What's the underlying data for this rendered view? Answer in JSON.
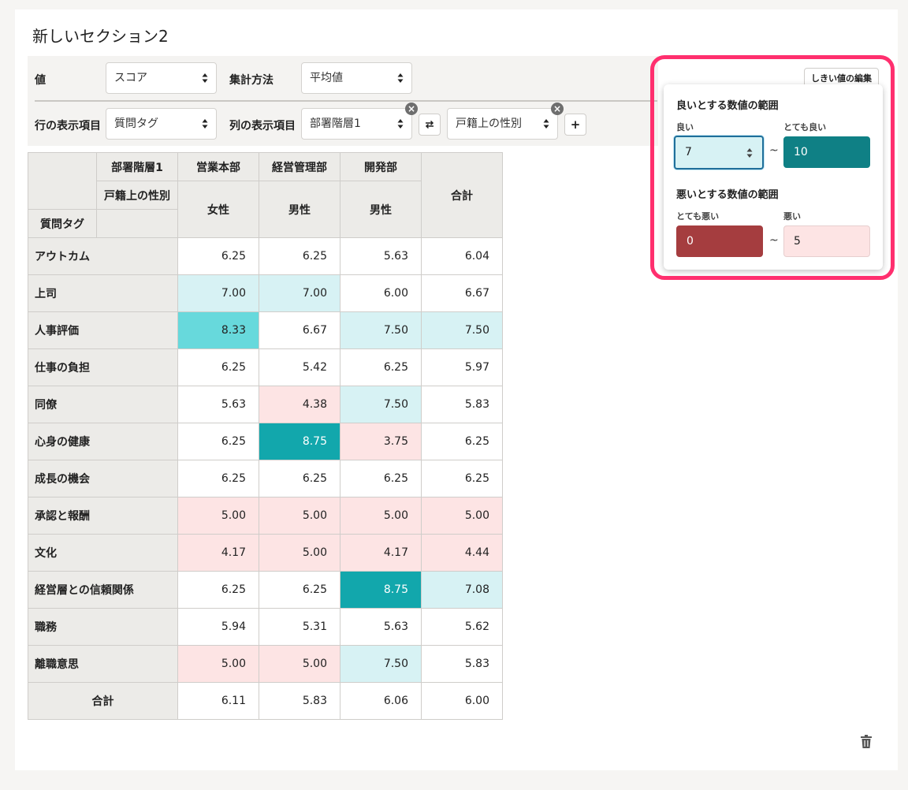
{
  "section": {
    "title": "新しいセクション2"
  },
  "toolbar": {
    "value_label": "値",
    "value_select": "スコア",
    "aggregation_label": "集計方法",
    "aggregation_select": "平均値",
    "row_label": "行の表示項目",
    "row_select": "質問タグ",
    "column_label": "列の表示項目",
    "column_select_1": "部署階層1",
    "column_select_2": "戸籍上の性別",
    "swap_icon": "swap-arrows-icon",
    "add_label": "+",
    "remove_icon": "close-circle-icon",
    "threshold_button": "しきい値の編集"
  },
  "table": {
    "dim1_label": "部署階層1",
    "dim2_label": "戸籍上の性別",
    "row_dim_label": "質問タグ",
    "columns": [
      {
        "dept": "営業本部",
        "gender": "女性"
      },
      {
        "dept": "経営管理部",
        "gender": "男性"
      },
      {
        "dept": "開発部",
        "gender": "男性"
      }
    ],
    "total_col_label": "合計",
    "rows": [
      {
        "label": "アウトカム",
        "values": [
          "6.25",
          "6.25",
          "5.63",
          "6.04"
        ]
      },
      {
        "label": "上司",
        "values": [
          "7.00",
          "7.00",
          "6.00",
          "6.67"
        ]
      },
      {
        "label": "人事評価",
        "values": [
          "8.33",
          "6.67",
          "7.50",
          "7.50"
        ]
      },
      {
        "label": "仕事の負担",
        "values": [
          "6.25",
          "5.42",
          "6.25",
          "5.97"
        ]
      },
      {
        "label": "同僚",
        "values": [
          "5.63",
          "4.38",
          "7.50",
          "5.83"
        ]
      },
      {
        "label": "心身の健康",
        "values": [
          "6.25",
          "8.75",
          "3.75",
          "6.25"
        ]
      },
      {
        "label": "成長の機会",
        "values": [
          "6.25",
          "6.25",
          "6.25",
          "6.25"
        ]
      },
      {
        "label": "承認と報酬",
        "values": [
          "5.00",
          "5.00",
          "5.00",
          "5.00"
        ]
      },
      {
        "label": "文化",
        "values": [
          "4.17",
          "5.00",
          "4.17",
          "4.44"
        ]
      },
      {
        "label": "経営層との信頼関係",
        "values": [
          "6.25",
          "6.25",
          "8.75",
          "7.08"
        ]
      },
      {
        "label": "職務",
        "values": [
          "5.94",
          "5.31",
          "5.63",
          "5.62"
        ]
      },
      {
        "label": "離職意思",
        "values": [
          "5.00",
          "5.00",
          "7.50",
          "5.83"
        ]
      }
    ],
    "total_row": {
      "label": "合計",
      "values": [
        "6.11",
        "5.83",
        "6.06",
        "6.00"
      ]
    }
  },
  "threshold_popover": {
    "good_title": "良いとする数値の範囲",
    "good_label": "良い",
    "very_good_label": "とても良い",
    "good_value": "7",
    "very_good_value": "10",
    "bad_title": "悪いとする数値の範囲",
    "very_bad_label": "とても悪い",
    "bad_label": "悪い",
    "very_bad_value": "0",
    "bad_value": "5",
    "range_separator": "~"
  },
  "colors": {
    "highlight": "#ff2f6e",
    "good_input": "#d7f2f4",
    "very_good_input": "#0f8085",
    "very_bad_input": "#a53d3f",
    "bad_input": "#fde4e4"
  },
  "icons": {
    "delete": "trash-icon"
  }
}
